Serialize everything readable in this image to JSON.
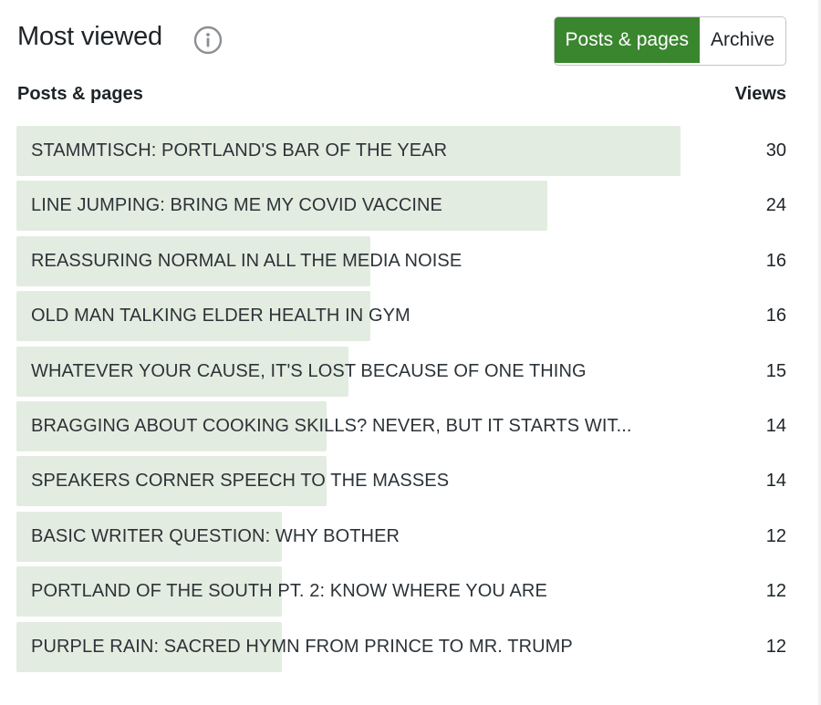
{
  "header": {
    "title": "Most viewed",
    "info_icon": "info-icon",
    "toggle": {
      "posts_label": "Posts & pages",
      "archive_label": "Archive",
      "active": "posts"
    }
  },
  "columns": {
    "left": "Posts & pages",
    "right": "Views"
  },
  "colors": {
    "accent": "#3a862f",
    "bar": "#e3ece0"
  },
  "max_views": 30,
  "rows": [
    {
      "title": "STAMMTISCH: PORTLAND'S BAR OF THE YEAR",
      "views": "30",
      "value": 30
    },
    {
      "title": "LINE JUMPING: BRING ME MY COVID VACCINE",
      "views": "24",
      "value": 24
    },
    {
      "title": "REASSURING NORMAL IN ALL THE MEDIA NOISE",
      "views": "16",
      "value": 16
    },
    {
      "title": "OLD MAN TALKING ELDER HEALTH IN GYM",
      "views": "16",
      "value": 16
    },
    {
      "title": "WHATEVER YOUR CAUSE, IT'S LOST BECAUSE OF ONE THING",
      "views": "15",
      "value": 15
    },
    {
      "title": "BRAGGING ABOUT COOKING SKILLS? NEVER, BUT IT STARTS WIT...",
      "views": "14",
      "value": 14
    },
    {
      "title": "SPEAKERS CORNER SPEECH TO THE MASSES",
      "views": "14",
      "value": 14
    },
    {
      "title": "BASIC WRITER QUESTION: WHY BOTHER",
      "views": "12",
      "value": 12
    },
    {
      "title": "PORTLAND OF THE SOUTH PT. 2: KNOW WHERE YOU ARE",
      "views": "12",
      "value": 12
    },
    {
      "title": "PURPLE RAIN: SACRED HYMN FROM PRINCE TO MR. TRUMP",
      "views": "12",
      "value": 12
    }
  ]
}
